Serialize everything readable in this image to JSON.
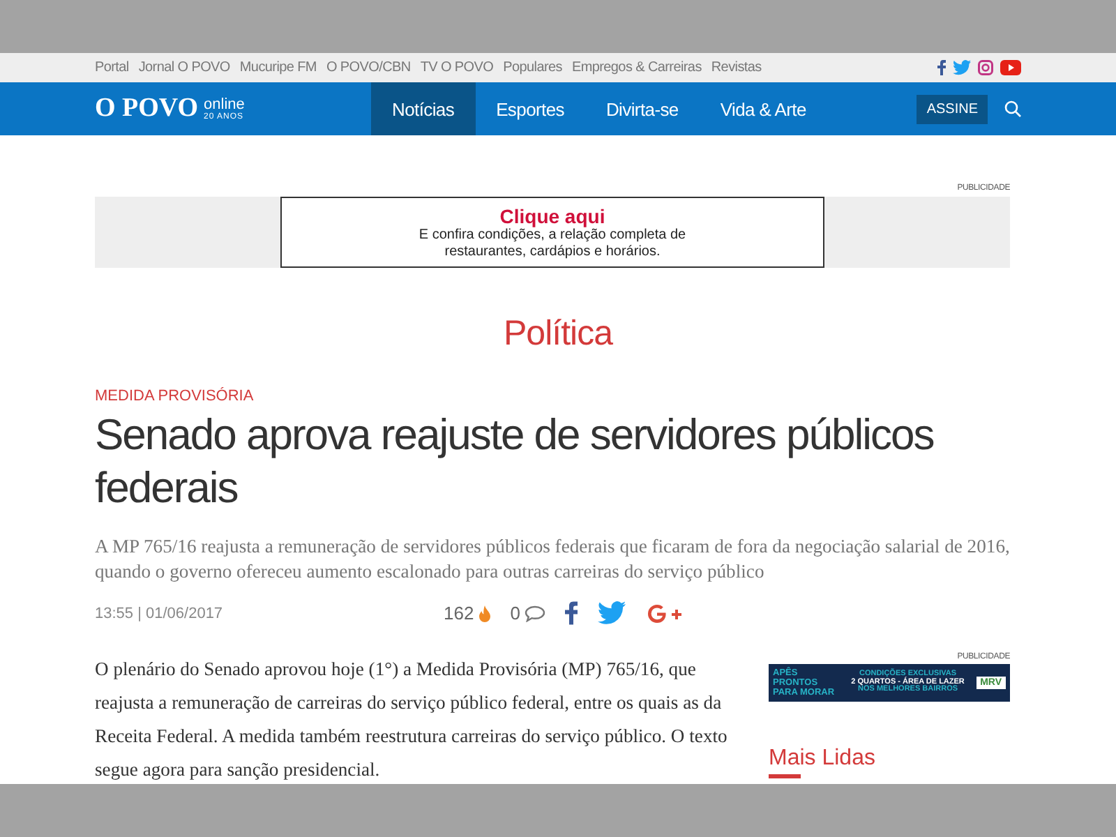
{
  "top_links": [
    "Portal",
    "Jornal O POVO",
    "Mucuripe FM",
    "O POVO/CBN",
    "TV O POVO",
    "Populares",
    "Empregos & Carreiras",
    "Revistas"
  ],
  "logo": {
    "name": "O POVO",
    "sub": "online",
    "years": "20 ANOS"
  },
  "tabs": [
    {
      "label": "Notícias",
      "selected": true
    },
    {
      "label": "Esportes",
      "selected": false
    },
    {
      "label": "Divirta-se",
      "selected": false
    },
    {
      "label": "Vida & Arte",
      "selected": false
    }
  ],
  "subscribe": "ASSINE",
  "top_ad": {
    "label": "PUBLICIDADE",
    "title": "Clique aqui",
    "text": "E confira condições, a relação completa de restaurantes, cardápios e horários."
  },
  "section": "Política",
  "article": {
    "kicker": "MEDIDA PROVISÓRIA",
    "headline": "Senado aprova reajuste de servidores públicos federais",
    "lede": "A MP 765/16 reajusta a remuneração de servidores públicos federais que ficaram de fora da negociação salarial de 2016, quando o governo ofereceu aumento escalonado para outras carreiras do serviço público",
    "date": "13:55 | 01/06/2017",
    "views": "162",
    "comments": "0",
    "body": "O plenário do Senado aprovou hoje (1°) a Medida Provisória (MP) 765/16, que reajusta a remuneração de carreiras do serviço público federal, entre os quais as da Receita Federal. A medida também reestrutura carreiras do serviço público. O texto segue agora para sanção presidencial."
  },
  "side_ad": {
    "label": "PUBLICIDADE",
    "left": "APÊS PRONTOS PARA MORAR",
    "line_1": "CONDIÇÕES EXCLUSIVAS",
    "line_2": "2 QUARTOS - ÁREA DE LAZER",
    "line_3": "NOS MELHORES BAIRROS",
    "brand": "MRV"
  },
  "most_read": "Mais Lidas"
}
